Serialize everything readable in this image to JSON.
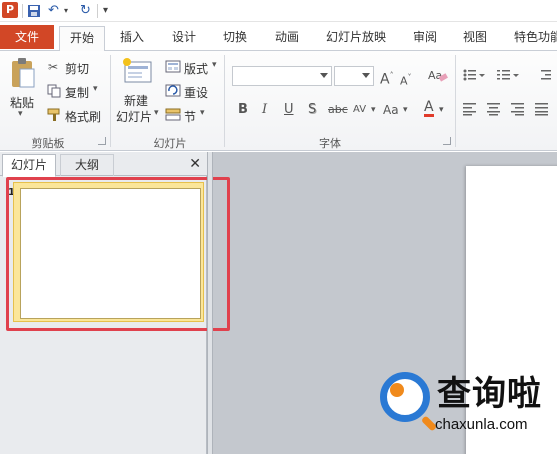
{
  "quick_access": {
    "app_logo": "P",
    "save_icon": "save-icon",
    "undo_glyph": "↶",
    "redo_glyph": "↻",
    "customize_glyph": "▾"
  },
  "ribbon_tabs": [
    "文件",
    "开始",
    "插入",
    "设计",
    "切换",
    "动画",
    "幻灯片放映",
    "审阅",
    "视图",
    "特色功能"
  ],
  "active_tab": "开始",
  "clipboard": {
    "paste_label": "粘贴",
    "cut_label": "剪切",
    "copy_label": "复制",
    "format_painter_label": "格式刷",
    "group_label": "剪贴板"
  },
  "slides_group": {
    "new_slide_line1": "新建",
    "new_slide_line2": "幻灯片",
    "layout_label": "版式",
    "reset_label": "重设",
    "section_label": "节",
    "group_label": "幻灯片"
  },
  "font_group": {
    "font_name": "",
    "font_size": "",
    "bold": "B",
    "italic": "I",
    "underline": "U",
    "shadow": "S",
    "strike": "abc",
    "spacing": "AV",
    "case": "Aa",
    "color": "A",
    "group_label": "字体"
  },
  "panel": {
    "tab_slides": "幻灯片",
    "tab_outline": "大纲",
    "close_glyph": "✕",
    "slide_number": "1"
  },
  "watermark": {
    "title": "查询啦",
    "url": "chaxunla.com"
  },
  "colors": {
    "file_tab": "#d24726",
    "selection_highlight": "#fbe69a",
    "annotation_box": "#e0414d",
    "watermark_blue": "#2a79d4",
    "watermark_orange": "#f08a1c"
  }
}
